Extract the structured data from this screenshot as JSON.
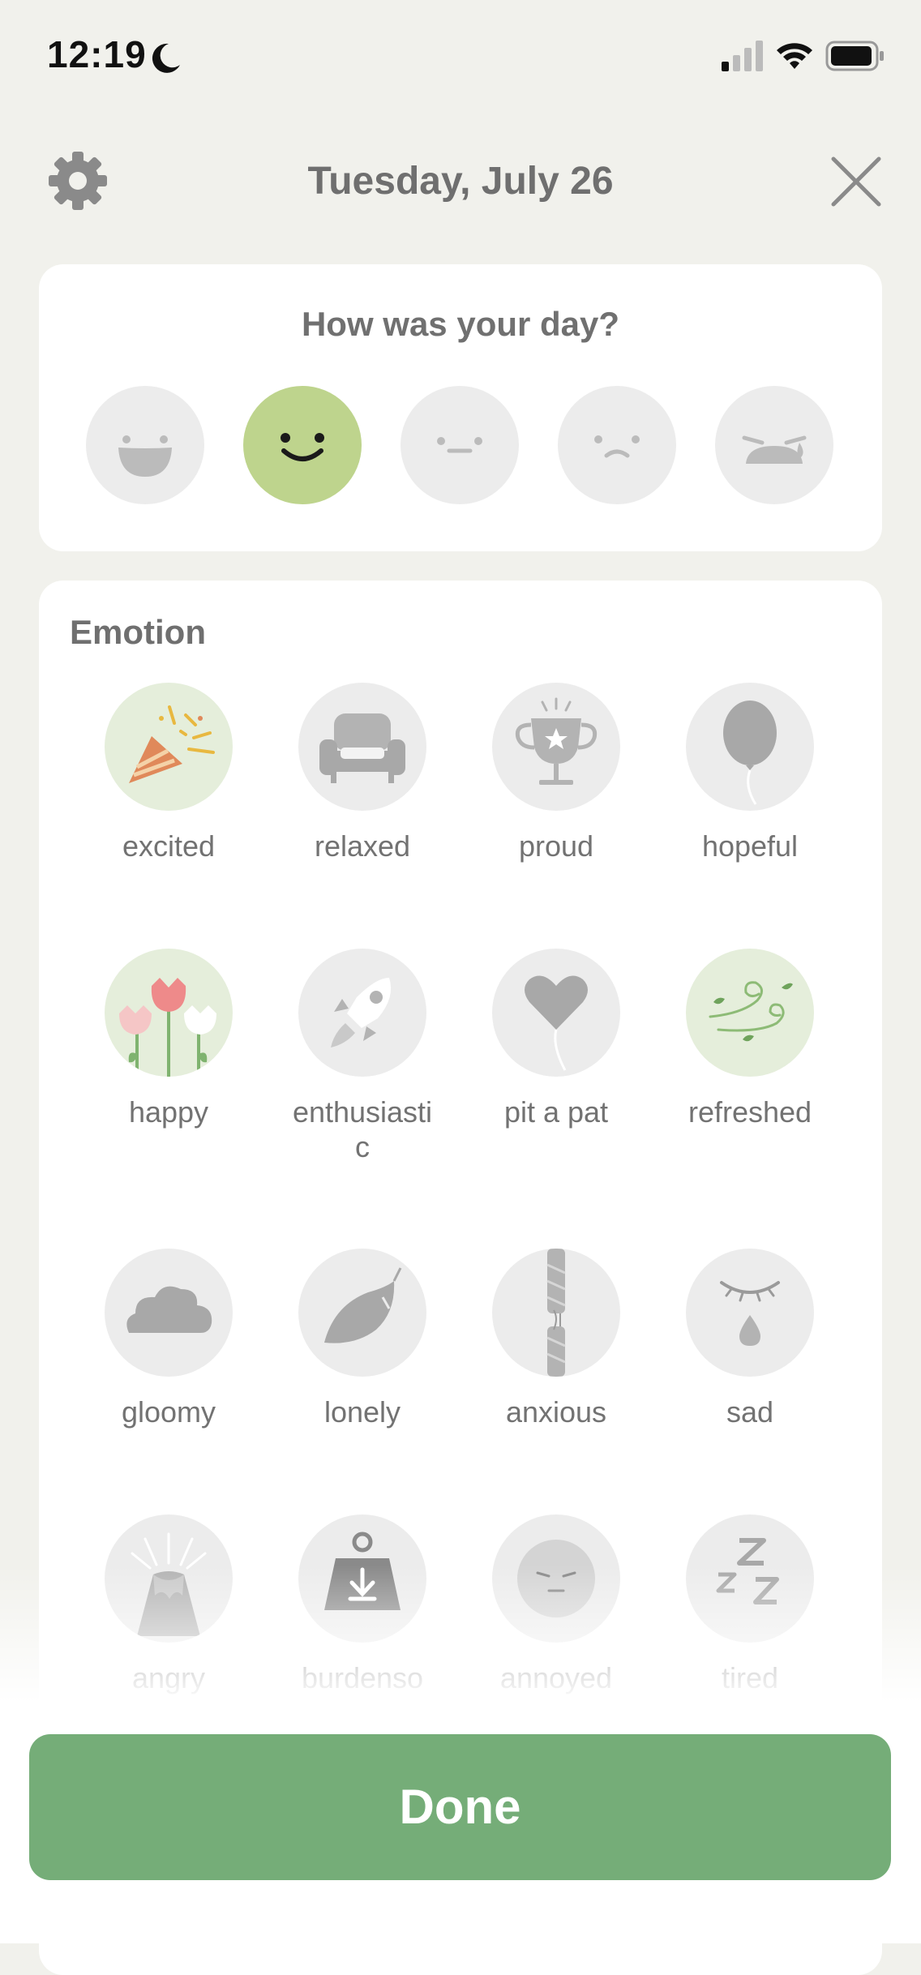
{
  "status_bar": {
    "time": "12:19",
    "icons": [
      "moon-icon",
      "signal-icon",
      "wifi-icon",
      "battery-icon"
    ]
  },
  "header": {
    "title": "Tuesday, July 26",
    "left_icon": "gear-icon",
    "right_icon": "close-icon"
  },
  "mood": {
    "question": "How was your day?",
    "faces": [
      {
        "name": "great",
        "selected": false
      },
      {
        "name": "good",
        "selected": true
      },
      {
        "name": "okay",
        "selected": false
      },
      {
        "name": "bad",
        "selected": false
      },
      {
        "name": "awful",
        "selected": false
      }
    ],
    "selected_color": "#bed48d"
  },
  "emotion": {
    "title": "Emotion",
    "items": [
      {
        "label": "excited",
        "icon": "party-popper-icon",
        "active": true
      },
      {
        "label": "relaxed",
        "icon": "armchair-icon",
        "active": false
      },
      {
        "label": "proud",
        "icon": "trophy-icon",
        "active": false
      },
      {
        "label": "hopeful",
        "icon": "balloon-icon",
        "active": false
      },
      {
        "label": "happy",
        "icon": "tulips-icon",
        "active": true
      },
      {
        "label": "enthusiastic",
        "icon": "rocket-icon",
        "active": false
      },
      {
        "label": "pit a pat",
        "icon": "heart-balloon-icon",
        "active": false
      },
      {
        "label": "refreshed",
        "icon": "wind-icon",
        "active": true
      },
      {
        "label": "gloomy",
        "icon": "cloud-icon",
        "active": false
      },
      {
        "label": "lonely",
        "icon": "leaf-icon",
        "active": false
      },
      {
        "label": "anxious",
        "icon": "rope-icon",
        "active": false
      },
      {
        "label": "sad",
        "icon": "teardrop-icon",
        "active": false
      },
      {
        "label": "angry",
        "icon": "volcano-icon",
        "active": false
      },
      {
        "label": "burdenso",
        "icon": "weight-icon",
        "active": false
      },
      {
        "label": "annoyed",
        "icon": "annoyed-face-icon",
        "active": false
      },
      {
        "label": "tired",
        "icon": "zzz-icon",
        "active": false
      }
    ]
  },
  "done": {
    "label": "Done"
  },
  "colors": {
    "accent": "#75ad78",
    "background": "#f1f1ec",
    "inactive_circle": "#ececec",
    "active_circle": "#e5eedb"
  }
}
